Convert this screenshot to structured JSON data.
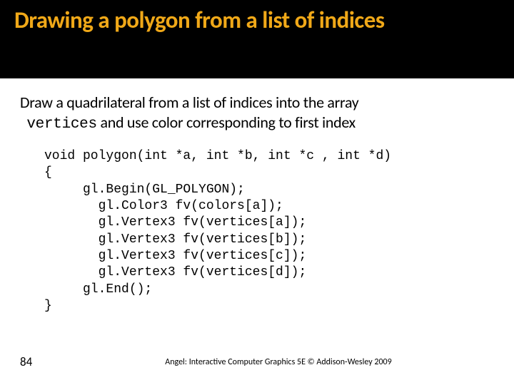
{
  "title": "Drawing a polygon from a list of indices",
  "body": {
    "line1_a": "Draw a quadrilateral from a list of indices into the array ",
    "line2_a": "vertices",
    "line2_b": " and use color corresponding to first index"
  },
  "code": "void polygon(int *a, int *b, int *c , int *d)\n{\n     gl.Begin(GL_POLYGON);\n       gl.Color3 fv(colors[a]);\n       gl.Vertex3 fv(vertices[a]);\n       gl.Vertex3 fv(vertices[b]);\n       gl.Vertex3 fv(vertices[c]);\n       gl.Vertex3 fv(vertices[d]);\n     gl.End();\n}",
  "page_number": "84",
  "copyright": "Angel: Interactive Computer Graphics 5E © Addison-Wesley 2009"
}
